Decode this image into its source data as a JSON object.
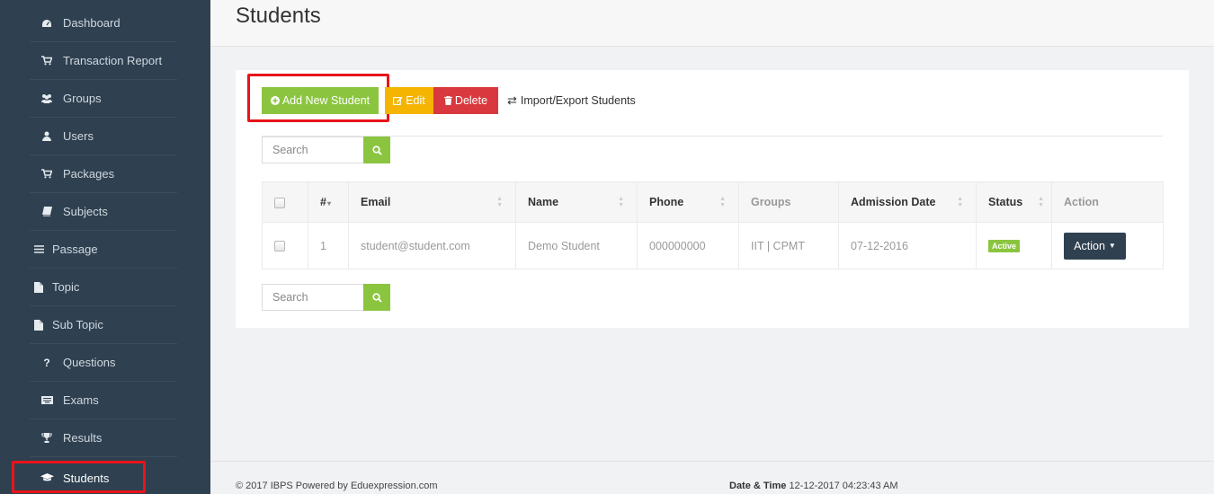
{
  "sidebar": {
    "items": [
      {
        "label": "Dashboard",
        "icon": "tachometer-icon"
      },
      {
        "label": "Transaction Report",
        "icon": "cart-icon"
      },
      {
        "label": "Groups",
        "icon": "users-icon"
      },
      {
        "label": "Users",
        "icon": "user-icon"
      },
      {
        "label": "Packages",
        "icon": "cart-icon"
      },
      {
        "label": "Subjects",
        "icon": "book-icon"
      },
      {
        "label": "Passage",
        "icon": "list-icon"
      },
      {
        "label": "Topic",
        "icon": "file-icon"
      },
      {
        "label": "Sub Topic",
        "icon": "file-icon"
      },
      {
        "label": "Questions",
        "icon": "question-icon"
      },
      {
        "label": "Exams",
        "icon": "keyboard-icon"
      },
      {
        "label": "Results",
        "icon": "trophy-icon"
      },
      {
        "label": "Students",
        "icon": "graduation-cap-icon"
      }
    ],
    "active": "Students"
  },
  "page": {
    "title": "Students"
  },
  "toolbar": {
    "add_label": "Add New Student",
    "edit_label": "Edit",
    "delete_label": "Delete",
    "import_label": "Import/Export Students"
  },
  "search": {
    "placeholder": "Search"
  },
  "table": {
    "headers": {
      "num": "#",
      "email": "Email",
      "name": "Name",
      "phone": "Phone",
      "groups": "Groups",
      "admission": "Admission Date",
      "status": "Status",
      "action": "Action"
    },
    "rows": [
      {
        "num": "1",
        "email": "student@student.com",
        "name": "Demo Student",
        "phone": "000000000",
        "groups": "IIT | CPMT",
        "admission": "07-12-2016",
        "status": "Active",
        "action": "Action"
      }
    ]
  },
  "footer": {
    "copyright": "© 2017 IBPS Powered by Eduexpression.com",
    "datetime_label": "Date & Time",
    "datetime_value": "12-12-2017 04:23:43 AM"
  },
  "colors": {
    "sidebar_bg": "#2f4050",
    "add": "#8bc540",
    "edit": "#f4b400",
    "delete": "#d9383e",
    "highlight": "#e8141b"
  }
}
